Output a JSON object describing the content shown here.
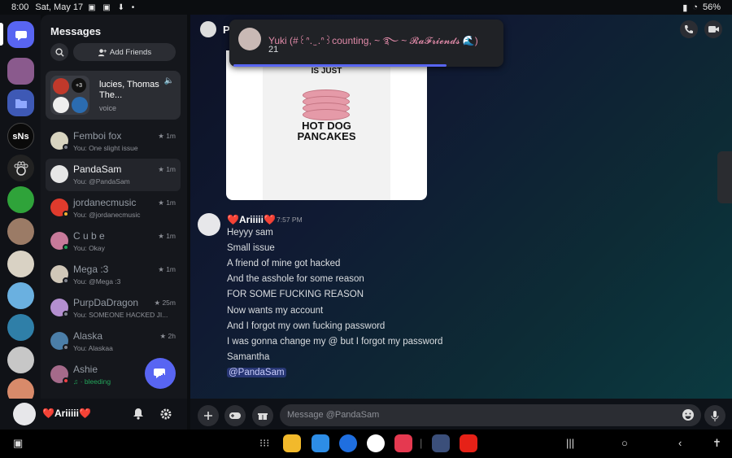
{
  "statusbar": {
    "time": "8:00",
    "date": "Sat, May 17",
    "battery": "56%"
  },
  "sidebar": {
    "title": "Messages",
    "add_friends": "Add Friends",
    "servers": [
      {
        "label": "",
        "color": "#5865f2"
      },
      {
        "label": "",
        "color": "#8a5a8d"
      },
      {
        "label": "",
        "color": "#3e59b5"
      },
      {
        "label": "sNs",
        "color": "#0a0a0a"
      },
      {
        "label": "",
        "color": "#222222"
      },
      {
        "label": "",
        "color": "#2fa33a"
      },
      {
        "label": "",
        "color": "#9b7b66"
      },
      {
        "label": "",
        "color": "#d9d2c4"
      },
      {
        "label": "",
        "color": "#6ab0e0"
      },
      {
        "label": "",
        "color": "#2f7fa8"
      },
      {
        "label": "",
        "color": "#c7c7c7"
      },
      {
        "label": "",
        "color": "#d88a6a"
      }
    ],
    "voice": {
      "names": "lucies, Thomas The...",
      "type": "voice",
      "badge": "+3"
    },
    "dms": [
      {
        "name": "Femboi fox",
        "sub": "You: One slight issue",
        "time": "1m",
        "color": "#d8d4c0"
      },
      {
        "name": "PandaSam",
        "sub": "You: @PandaSam",
        "time": "1m",
        "color": "#e6e6e6"
      },
      {
        "name": "jordanecmusic",
        "sub": "You: @jordanecmusic",
        "time": "1m",
        "color": "#e03b2d"
      },
      {
        "name": "C u b e",
        "sub": "You: Okay",
        "time": "1m",
        "color": "#c77a9a"
      },
      {
        "name": "Mega :3",
        "sub": "You: @Mega :3",
        "time": "1m",
        "color": "#d0c7b8"
      },
      {
        "name": "PurpDaDragon",
        "sub": "You: SOMEONE HACKED JI...",
        "time": "25m",
        "color": "#b48fd0"
      },
      {
        "name": "Alaska",
        "sub": "You: Alaskaa",
        "time": "2h",
        "color": "#4b7ea8"
      },
      {
        "name": "Ashie",
        "sub": "♫ · bleeding",
        "time": "",
        "color": "#a56a8a"
      }
    ]
  },
  "user": {
    "name": "❤️Ariiiii❤️"
  },
  "chat": {
    "header_name": "P",
    "notification": {
      "from": "Yuki (#꒰ᐢ. ̫ .ᐢ꒱counting, ~ ࿐ ~ 𝓡𝓪𝓕𝓻𝓲𝓮𝓷𝓭𝓼 🌊)",
      "text": "21"
    },
    "image": {
      "top_text": "IS JUST",
      "bottom_text_1": "HOT DOG",
      "bottom_text_2": "PANCAKES"
    },
    "author": "❤️Ariiiii❤️",
    "time": "7:57 PM",
    "lines": [
      "Heyyy sam",
      "Small issue",
      "A friend of mine got hacked",
      "And the asshole for some reason",
      "FOR SOME FUCKING REASON",
      "Now wants my account",
      "And I forgot my own fucking password",
      "I was gonna change my @ but I forgot my password",
      "Samantha"
    ],
    "mention": "@PandaSam"
  },
  "composer": {
    "placeholder": "Message @PandaSam"
  },
  "colors": {
    "accent": "#5865f2",
    "mention": "#c9cdfb"
  }
}
